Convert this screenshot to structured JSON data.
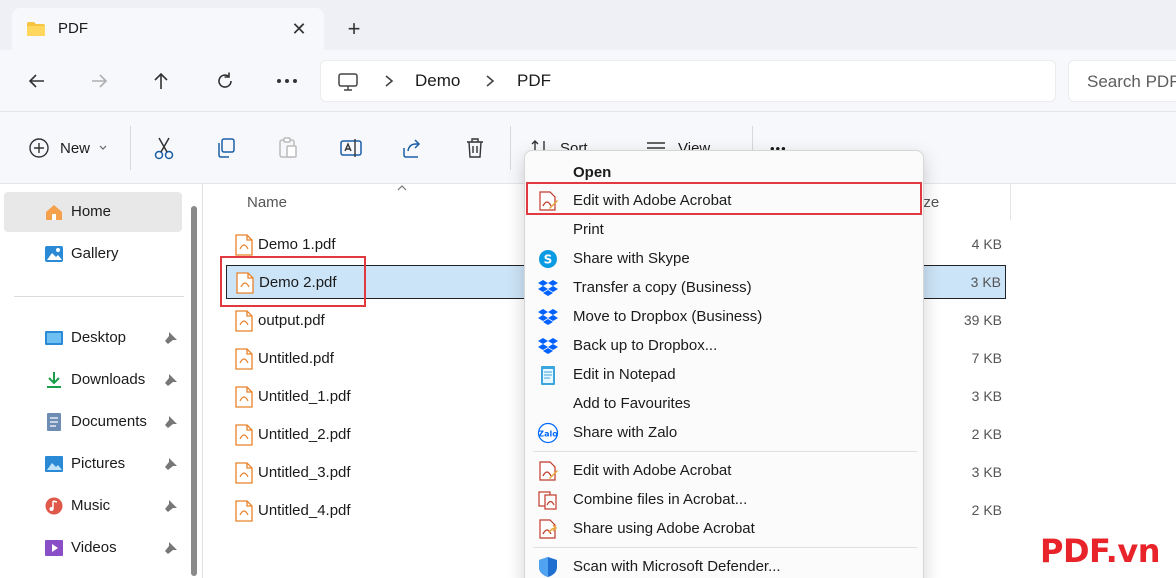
{
  "tab": {
    "title": "PDF",
    "close_glyph": "✕",
    "new_tab_glyph": "+"
  },
  "address": {
    "crumbs": [
      "Demo",
      "PDF"
    ],
    "search_placeholder": "Search PDF"
  },
  "toolbar": {
    "new_label": "New",
    "sort_label": "Sort",
    "view_label": "View",
    "more_glyph": "•••"
  },
  "columns": {
    "name": "Name",
    "size": "ize"
  },
  "sidebar": {
    "items": [
      {
        "label": "Home",
        "icon": "home-icon"
      },
      {
        "label": "Gallery",
        "icon": "gallery-icon"
      },
      {
        "label": "Desktop",
        "icon": "desktop-icon"
      },
      {
        "label": "Downloads",
        "icon": "download-icon"
      },
      {
        "label": "Documents",
        "icon": "documents-icon"
      },
      {
        "label": "Pictures",
        "icon": "pictures-icon"
      },
      {
        "label": "Music",
        "icon": "music-icon"
      },
      {
        "label": "Videos",
        "icon": "videos-icon"
      }
    ]
  },
  "files": [
    {
      "name": "Demo 1.pdf",
      "size": "4 KB"
    },
    {
      "name": "Demo 2.pdf",
      "size": "3 KB"
    },
    {
      "name": "output.pdf",
      "size": "39 KB"
    },
    {
      "name": "Untitled.pdf",
      "size": "7 KB"
    },
    {
      "name": "Untitled_1.pdf",
      "size": "3 KB"
    },
    {
      "name": "Untitled_2.pdf",
      "size": "2 KB"
    },
    {
      "name": "Untitled_3.pdf",
      "size": "3 KB"
    },
    {
      "name": "Untitled_4.pdf",
      "size": "2 KB"
    }
  ],
  "context_menu": {
    "items": [
      {
        "label": "Open",
        "icon": "none"
      },
      {
        "label": "Edit with Adobe Acrobat",
        "icon": "acrobat-edit-icon"
      },
      {
        "label": "Print",
        "icon": "none"
      },
      {
        "label": "Share with Skype",
        "icon": "skype-icon"
      },
      {
        "label": "Transfer a copy (Business)",
        "icon": "dropbox-icon"
      },
      {
        "label": "Move to Dropbox (Business)",
        "icon": "dropbox-icon"
      },
      {
        "label": "Back up to Dropbox...",
        "icon": "dropbox-icon"
      },
      {
        "label": "Edit in Notepad",
        "icon": "notepad-icon"
      },
      {
        "label": "Add to Favourites",
        "icon": "none"
      },
      {
        "label": "Share with Zalo",
        "icon": "zalo-icon"
      },
      {
        "label": "Edit with Adobe Acrobat",
        "icon": "acrobat-edit-icon"
      },
      {
        "label": "Combine files in Acrobat...",
        "icon": "acrobat-combine-icon"
      },
      {
        "label": "Share using Adobe Acrobat",
        "icon": "acrobat-share-icon"
      },
      {
        "label": "Scan with Microsoft Defender...",
        "icon": "defender-icon"
      }
    ]
  },
  "watermark": "PDF.vn",
  "colors": {
    "highlight": "#e0393e",
    "selection": "#cce4f7",
    "accent": "#0067c0",
    "pdf_orange": "#e8822a"
  }
}
